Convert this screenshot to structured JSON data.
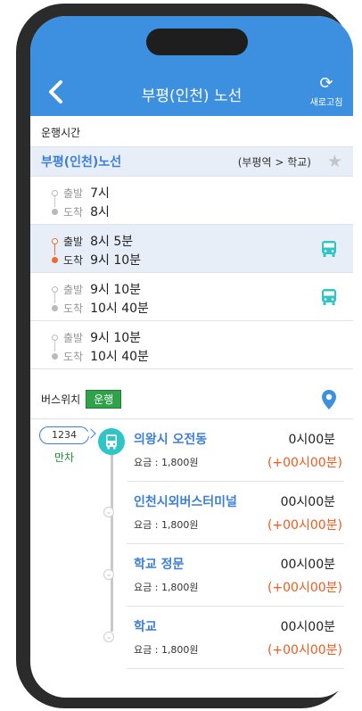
{
  "header": {
    "title": "부평(인천) 노선",
    "refresh_label": "새로고침"
  },
  "schedule_section": {
    "label": "운행시간"
  },
  "route": {
    "name": "부평(인천)노선",
    "direction": "(부평역 > 학교)"
  },
  "labels": {
    "depart": "출발",
    "arrive": "도착"
  },
  "schedules": [
    {
      "depart": "7시",
      "arrive": "8시",
      "active": false,
      "bus": false
    },
    {
      "depart": "8시 5분",
      "arrive": "9시 10분",
      "active": true,
      "bus": true
    },
    {
      "depart": "9시 10분",
      "arrive": "10시 40분",
      "active": false,
      "bus": true
    },
    {
      "depart": "9시 10분",
      "arrive": "10시 40분",
      "active": false,
      "bus": false
    }
  ],
  "bus_position": {
    "label": "버스위치",
    "status_badge": "운행",
    "bus_number": "1234",
    "bus_status": "만차"
  },
  "stops": [
    {
      "name": "의왕시 오전동",
      "fare": "요금 : 1,800원",
      "time": "0시00분",
      "delay": "(+00시00분)"
    },
    {
      "name": "인천시외버스터미널",
      "fare": "요금 : 1,800원",
      "time": "00시00분",
      "delay": "(+00시00분)"
    },
    {
      "name": "학교 정문",
      "fare": "요금 : 1,800원",
      "time": "00시00분",
      "delay": "(+00시00분)"
    },
    {
      "name": "학교",
      "fare": "요금 : 1,800원",
      "time": "00시00분",
      "delay": "(+00시00분)"
    }
  ],
  "colors": {
    "header": "#3d8fe0",
    "accent_blue": "#3d7fd6",
    "active_orange": "#f06a2f",
    "bus_teal": "#2fc4c7",
    "delay_red": "#f05a1e",
    "status_green": "#2fa24a"
  },
  "icons": {
    "back": "chevron-left-icon",
    "refresh": "refresh-icon",
    "favorite": "star-icon",
    "bus": "bus-icon",
    "location": "map-pin-icon",
    "stop": "chevron-down-icon"
  }
}
